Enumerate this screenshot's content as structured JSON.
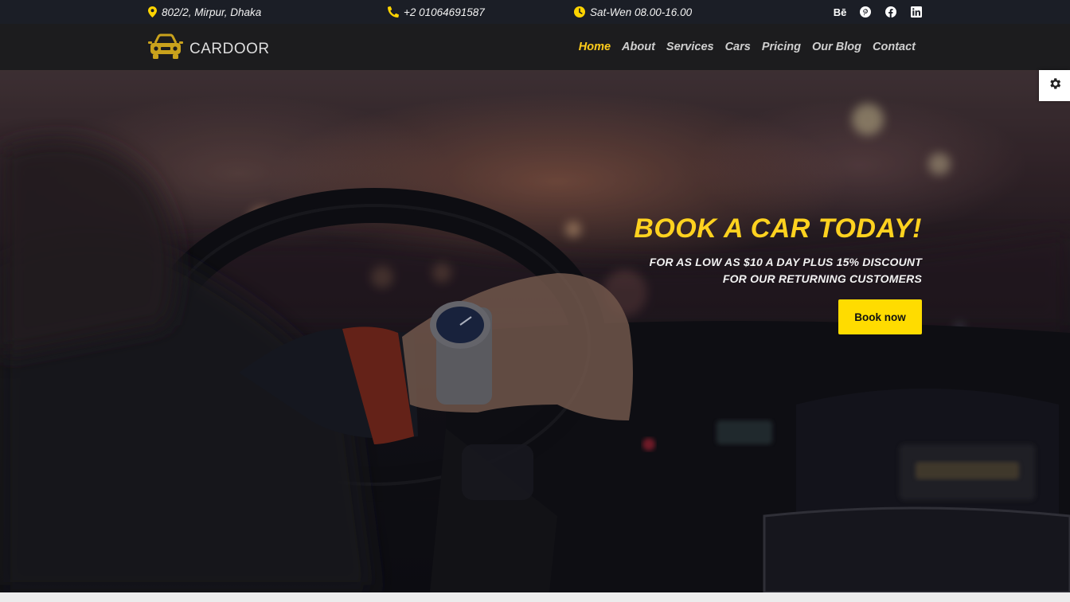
{
  "topbar": {
    "address": "802/2, Mirpur, Dhaka",
    "phone": "+2 01064691587",
    "hours": "Sat-Wen 08.00-16.00",
    "icons": {
      "address": "map-pin-icon",
      "phone": "phone-icon",
      "hours": "clock-icon"
    },
    "socials": [
      {
        "name": "behance-icon",
        "label": "Bē"
      },
      {
        "name": "pinterest-icon"
      },
      {
        "name": "facebook-icon"
      },
      {
        "name": "linkedin-icon"
      }
    ]
  },
  "navbar": {
    "logo_text": "CARDOOR",
    "items": [
      {
        "label": "Home",
        "active": true
      },
      {
        "label": "About"
      },
      {
        "label": "Services"
      },
      {
        "label": "Cars"
      },
      {
        "label": "Pricing"
      },
      {
        "label": "Our Blog"
      },
      {
        "label": "Contact"
      }
    ]
  },
  "hero": {
    "title": "BOOK A CAR TODAY!",
    "subtitle_line1": "FOR AS LOW AS $10 A DAY PLUS 15% DISCOUNT",
    "subtitle_line2": "FOR OUR RETURNING CUSTOMERS",
    "button_label": "Book now"
  },
  "colors": {
    "accent": "#ffd21f",
    "button": "#ffdc00",
    "topbar_bg": "#1b1e26",
    "navbar_bg": "#1c1c1e"
  }
}
